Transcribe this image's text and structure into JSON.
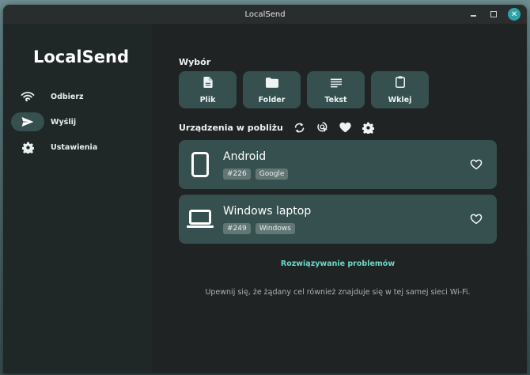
{
  "window": {
    "title": "LocalSend"
  },
  "sidebar": {
    "brand": "LocalSend",
    "items": [
      {
        "label": "Odbierz",
        "icon": "wifi-icon",
        "active": false
      },
      {
        "label": "Wyślij",
        "icon": "send-icon",
        "active": true
      },
      {
        "label": "Ustawienia",
        "icon": "gear-icon",
        "active": false
      }
    ]
  },
  "main": {
    "selection_title": "Wybór",
    "picks": [
      {
        "label": "Plik",
        "icon": "file-icon"
      },
      {
        "label": "Folder",
        "icon": "folder-icon"
      },
      {
        "label": "Tekst",
        "icon": "text-icon"
      },
      {
        "label": "Wklej",
        "icon": "clipboard-icon"
      }
    ],
    "nearby_title": "Urządzenia w pobliżu",
    "nearby_actions": [
      "refresh-icon",
      "scan-target-icon",
      "favorite-icon",
      "settings-icon"
    ],
    "devices": [
      {
        "name": "Android",
        "icon": "phone-icon",
        "tags": [
          "#226",
          "Google"
        ]
      },
      {
        "name": "Windows laptop",
        "icon": "laptop-icon",
        "tags": [
          "#249",
          "Windows"
        ]
      }
    ],
    "troubleshoot_link": "Rozwiązywanie problemów",
    "hint": "Upewnij się, że żądany cel również znajduje się w tej samej sieci Wi-Fi."
  },
  "colors": {
    "accent": "#35504f",
    "link": "#6fd7c9",
    "close_button": "#2ba3a8"
  }
}
